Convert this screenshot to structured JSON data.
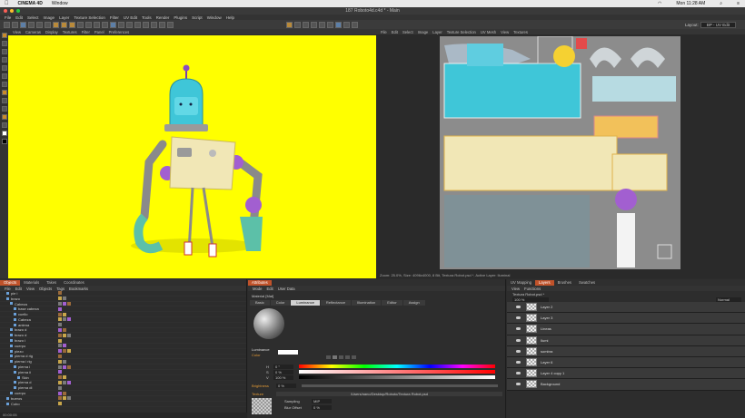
{
  "mac_menu": {
    "app": "CINEMA 4D",
    "items": [
      "Window"
    ],
    "clock": "Mon 11:28 AM"
  },
  "window_title": "187 Roboto4d.c4d * - Main",
  "menubar": [
    "File",
    "Edit",
    "Select",
    "Image",
    "Layer",
    "Texture Selection",
    "Filter",
    "UV Edit",
    "Tools",
    "Render",
    "Plugins",
    "Script",
    "Window",
    "Help"
  ],
  "layout": {
    "label": "Layout:",
    "value": "BP - UV Edit"
  },
  "viewport_menu": [
    "View",
    "Cameras",
    "Display",
    "Textures",
    "Filter",
    "Panel",
    "Preferences"
  ],
  "uv_menu": [
    "File",
    "Edit",
    "Select",
    "Image",
    "Layer",
    "Texture Selection",
    "UV Mesh",
    "View",
    "Textures"
  ],
  "uv_status": "Zoom: 25.0%, Size: 4096x4000, 8 Bit, Textura Robot.psd *, Active Layer: Iluminal",
  "object_tabs": [
    "Objects",
    "Materials",
    "Takes",
    "Coordinates"
  ],
  "object_menu": [
    "File",
    "Edit",
    "View",
    "Objects",
    "Tags",
    "Bookmarks"
  ],
  "objects": [
    {
      "name": "pie i",
      "indent": 1
    },
    {
      "name": "brazo",
      "indent": 1
    },
    {
      "name": "Cabeza",
      "indent": 2
    },
    {
      "name": "base cabeza",
      "indent": 3
    },
    {
      "name": "cuello",
      "indent": 3
    },
    {
      "name": "Cabeza",
      "indent": 3
    },
    {
      "name": "antena",
      "indent": 3
    },
    {
      "name": "brazo d",
      "indent": 2
    },
    {
      "name": "brazo d",
      "indent": 2
    },
    {
      "name": "brazo i",
      "indent": 2
    },
    {
      "name": "cuerpo",
      "indent": 2
    },
    {
      "name": "piezo",
      "indent": 2
    },
    {
      "name": "pierna d rig",
      "indent": 2
    },
    {
      "name": "pierna i rig",
      "indent": 2
    },
    {
      "name": "pierna i",
      "indent": 3
    },
    {
      "name": "pierna ii",
      "indent": 3
    },
    {
      "name": "Skin",
      "indent": 4
    },
    {
      "name": "pierna d",
      "indent": 3
    },
    {
      "name": "pierna di",
      "indent": 3
    },
    {
      "name": "cuerpo",
      "indent": 2
    },
    {
      "name": "bueros",
      "indent": 1
    },
    {
      "name": "Cubo",
      "indent": 1
    }
  ],
  "status_time": "00:00:05",
  "attr_tabs": [
    "Attributes"
  ],
  "attr_menu": [
    "Mode",
    "Edit",
    "User Data"
  ],
  "material_name": "Material [Mat]",
  "material_tabs": [
    "Basic",
    "Color",
    "Luminance",
    "Reflectance",
    "Illumination",
    "Editor",
    "Assign"
  ],
  "section_luminance": "Luminance",
  "color_label": "Color",
  "hsv": [
    {
      "k": "H",
      "v": "0 °"
    },
    {
      "k": "S",
      "v": "0 %"
    },
    {
      "k": "V",
      "v": "100 %"
    }
  ],
  "brightness": {
    "label": "Brightness",
    "value": "0 %"
  },
  "texture": {
    "label": "Texture",
    "path": "/Users/nano/Desktop/Roboto/Textura Robot.psd"
  },
  "sampling": {
    "label": "Sampling",
    "value": "MIP"
  },
  "blur": {
    "label": "Blur Offset",
    "value": "0 %"
  },
  "layer_tabs": [
    "UV Mapping",
    "Layers",
    "Brushes",
    "Swatches"
  ],
  "layer_menu": [
    "View",
    "Functions"
  ],
  "layer_file": "Textura Robot.psd *",
  "layer_opacity": "100 %",
  "layer_mode": "Normal",
  "layers": [
    "Layer 2",
    "Layer 3",
    "Lineas",
    "Ilumi",
    "sombra",
    "Layer 6",
    "Layer 4 copy 1",
    "Background"
  ],
  "colors": {
    "yellow": "#ffff00",
    "cyan": "#3fc6d8",
    "orange": "#c0522a",
    "purple": "#a25fd0",
    "grey_uv": "#8c8c8c"
  }
}
